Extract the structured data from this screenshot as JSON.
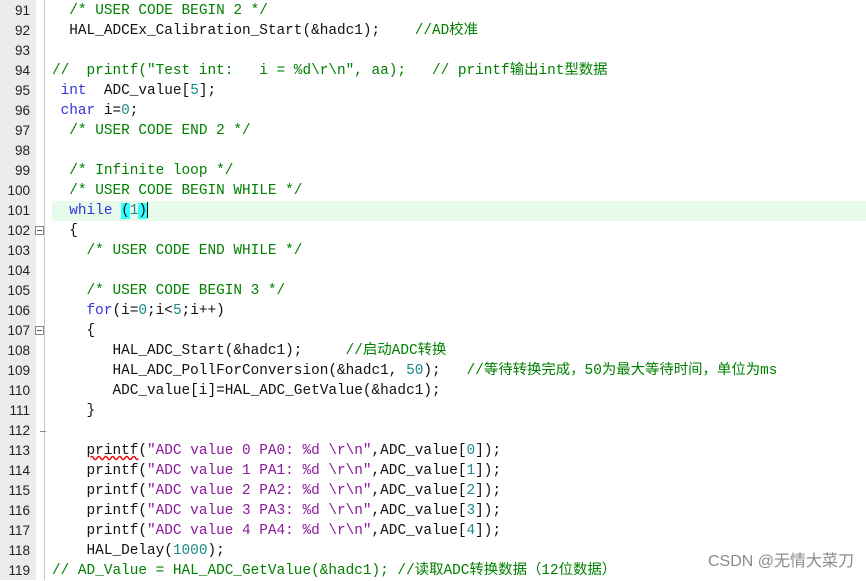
{
  "editor": {
    "highlight_color": "#e6fbe9",
    "lines": [
      {
        "n": "91",
        "tokens": [
          [
            "t",
            "  "
          ],
          [
            "comment",
            "/* USER CODE BEGIN 2 */"
          ]
        ]
      },
      {
        "n": "92",
        "tokens": [
          [
            "t",
            "  HAL_ADCEx_Calibration_Start(&hadc1);    "
          ],
          [
            "comment",
            "//AD校准"
          ]
        ]
      },
      {
        "n": "93",
        "tokens": []
      },
      {
        "n": "94",
        "tokens": [
          [
            "comment",
            "//  printf(\"Test int:   i = %d\\r\\n\", aa);   // printf输出int型数据"
          ]
        ]
      },
      {
        "n": "95",
        "tokens": [
          [
            "t",
            " "
          ],
          [
            "kw",
            "int"
          ],
          [
            "t",
            "  ADC_value["
          ],
          [
            "num",
            "5"
          ],
          [
            "t",
            "];"
          ]
        ]
      },
      {
        "n": "96",
        "tokens": [
          [
            "t",
            " "
          ],
          [
            "kw",
            "char"
          ],
          [
            "t",
            " i="
          ],
          [
            "num",
            "0"
          ],
          [
            "t",
            ";"
          ]
        ]
      },
      {
        "n": "97",
        "tokens": [
          [
            "t",
            "  "
          ],
          [
            "comment",
            "/* USER CODE END 2 */"
          ]
        ]
      },
      {
        "n": "98",
        "tokens": []
      },
      {
        "n": "99",
        "tokens": [
          [
            "t",
            "  "
          ],
          [
            "comment",
            "/* Infinite loop */"
          ]
        ]
      },
      {
        "n": "100",
        "tokens": [
          [
            "t",
            "  "
          ],
          [
            "comment",
            "/* USER CODE BEGIN WHILE */"
          ]
        ]
      },
      {
        "n": "101",
        "current": true,
        "tokens": [
          [
            "t",
            "  "
          ],
          [
            "kw",
            "while"
          ],
          [
            "t",
            " "
          ],
          [
            "brace",
            "("
          ],
          [
            "num",
            "1"
          ],
          [
            "brace",
            ")"
          ],
          [
            "caret",
            ""
          ]
        ]
      },
      {
        "n": "102",
        "fold": true,
        "tokens": [
          [
            "t",
            "  {"
          ]
        ]
      },
      {
        "n": "103",
        "tokens": [
          [
            "t",
            "    "
          ],
          [
            "comment",
            "/* USER CODE END WHILE */"
          ]
        ]
      },
      {
        "n": "104",
        "tokens": []
      },
      {
        "n": "105",
        "tokens": [
          [
            "t",
            "    "
          ],
          [
            "comment",
            "/* USER CODE BEGIN 3 */"
          ]
        ]
      },
      {
        "n": "106",
        "tokens": [
          [
            "t",
            "    "
          ],
          [
            "kw",
            "for"
          ],
          [
            "t",
            "(i="
          ],
          [
            "num",
            "0"
          ],
          [
            "t",
            ";i<"
          ],
          [
            "num",
            "5"
          ],
          [
            "t",
            ";i++)"
          ]
        ]
      },
      {
        "n": "107",
        "fold": true,
        "tokens": [
          [
            "t",
            "    {"
          ]
        ]
      },
      {
        "n": "108",
        "tokens": [
          [
            "t",
            "       HAL_ADC_Start(&hadc1);     "
          ],
          [
            "comment",
            "//启动ADC转换"
          ]
        ]
      },
      {
        "n": "109",
        "tokens": [
          [
            "t",
            "       HAL_ADC_PollForConversion(&hadc1, "
          ],
          [
            "num",
            "50"
          ],
          [
            "t",
            ");   "
          ],
          [
            "comment",
            "//等待转换完成，50为最大等待时间，单位为ms"
          ]
        ]
      },
      {
        "n": "110",
        "tokens": [
          [
            "t",
            "       ADC_value[i]=HAL_ADC_GetValue(&hadc1);"
          ]
        ]
      },
      {
        "n": "111",
        "tokens": [
          [
            "t",
            "    }"
          ]
        ]
      },
      {
        "n": "112",
        "foldend": true,
        "tokens": []
      },
      {
        "n": "113",
        "tokens": [
          [
            "t",
            "    "
          ],
          [
            "err",
            "printf"
          ],
          [
            "t",
            "("
          ],
          [
            "str",
            "\"ADC value 0 PA0: %d \\r\\n\""
          ],
          [
            "t",
            ",ADC_value["
          ],
          [
            "num",
            "0"
          ],
          [
            "t",
            "]);"
          ]
        ]
      },
      {
        "n": "114",
        "tokens": [
          [
            "t",
            "    printf("
          ],
          [
            "str",
            "\"ADC value 1 PA1: %d \\r\\n\""
          ],
          [
            "t",
            ",ADC_value["
          ],
          [
            "num",
            "1"
          ],
          [
            "t",
            "]);"
          ]
        ]
      },
      {
        "n": "115",
        "tokens": [
          [
            "t",
            "    printf("
          ],
          [
            "str",
            "\"ADC value 2 PA2: %d \\r\\n\""
          ],
          [
            "t",
            ",ADC_value["
          ],
          [
            "num",
            "2"
          ],
          [
            "t",
            "]);"
          ]
        ]
      },
      {
        "n": "116",
        "tokens": [
          [
            "t",
            "    printf("
          ],
          [
            "str",
            "\"ADC value 3 PA3: %d \\r\\n\""
          ],
          [
            "t",
            ",ADC_value["
          ],
          [
            "num",
            "3"
          ],
          [
            "t",
            "]);"
          ]
        ]
      },
      {
        "n": "117",
        "tokens": [
          [
            "t",
            "    printf("
          ],
          [
            "str",
            "\"ADC value 4 PA4: %d \\r\\n\""
          ],
          [
            "t",
            ",ADC_value["
          ],
          [
            "num",
            "4"
          ],
          [
            "t",
            "]);"
          ]
        ]
      },
      {
        "n": "118",
        "tokens": [
          [
            "t",
            "    HAL_Delay("
          ],
          [
            "num",
            "1000"
          ],
          [
            "t",
            ");"
          ]
        ]
      },
      {
        "n": "119",
        "tokens": [
          [
            "comment",
            "// AD_Value = HAL_ADC_GetValue(&hadc1); //读取ADC转换数据（12位数据）"
          ]
        ]
      }
    ]
  },
  "watermark": "CSDN @无情大菜刀"
}
